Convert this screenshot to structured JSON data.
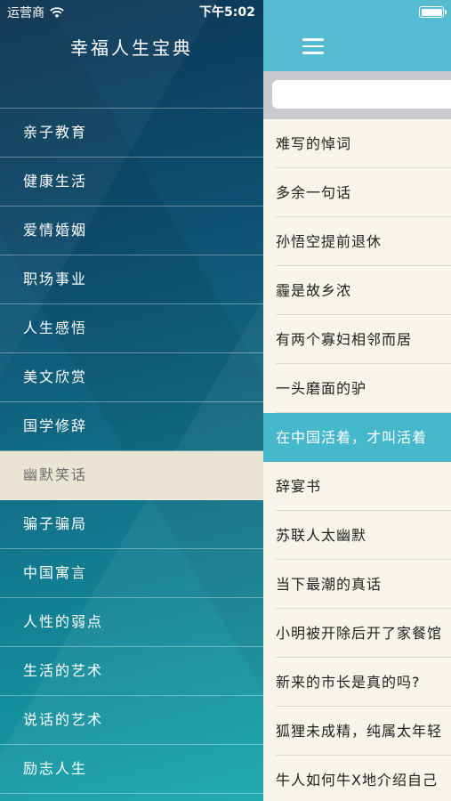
{
  "status_bar": {
    "carrier": "运营商",
    "time": "下午5:02"
  },
  "app": {
    "title": "幸福人生宝典"
  },
  "sidebar": {
    "items": [
      {
        "label": "亲子教育"
      },
      {
        "label": "健康生活"
      },
      {
        "label": "爱情婚姻"
      },
      {
        "label": "职场事业"
      },
      {
        "label": "人生感悟"
      },
      {
        "label": "美文欣赏"
      },
      {
        "label": "国学修辞"
      },
      {
        "label": "幽默笑话",
        "selected": true
      },
      {
        "label": "骗子骗局"
      },
      {
        "label": "中国寓言"
      },
      {
        "label": "人性的弱点"
      },
      {
        "label": "生活的艺术"
      },
      {
        "label": "说话的艺术"
      },
      {
        "label": "励志人生"
      }
    ]
  },
  "search": {
    "value": "",
    "placeholder": ""
  },
  "articles": {
    "items": [
      {
        "title": "难写的悼词"
      },
      {
        "title": "多余一句话"
      },
      {
        "title": "孙悟空提前退休"
      },
      {
        "title": "霾是故乡浓"
      },
      {
        "title": "有两个寡妇相邻而居"
      },
      {
        "title": "一头磨面的驴"
      },
      {
        "title": "在中国活着，才叫活着",
        "selected": true
      },
      {
        "title": "辞宴书"
      },
      {
        "title": "苏联人太幽默"
      },
      {
        "title": "当下最潮的真话"
      },
      {
        "title": "小明被开除后开了家餐馆"
      },
      {
        "title": "新来的市长是真的吗?"
      },
      {
        "title": "狐狸未成精，纯属太年轻"
      },
      {
        "title": "牛人如何牛X地介绍自己"
      }
    ]
  },
  "colors": {
    "nav_bar": "#54bbd0",
    "selected_article": "#45b8cc",
    "selected_menu": "#e9e4d3",
    "list_background": "#f7f4ea"
  },
  "icons": {
    "wifi": "wifi-icon",
    "battery": "battery-icon",
    "menu": "hamburger-icon"
  }
}
